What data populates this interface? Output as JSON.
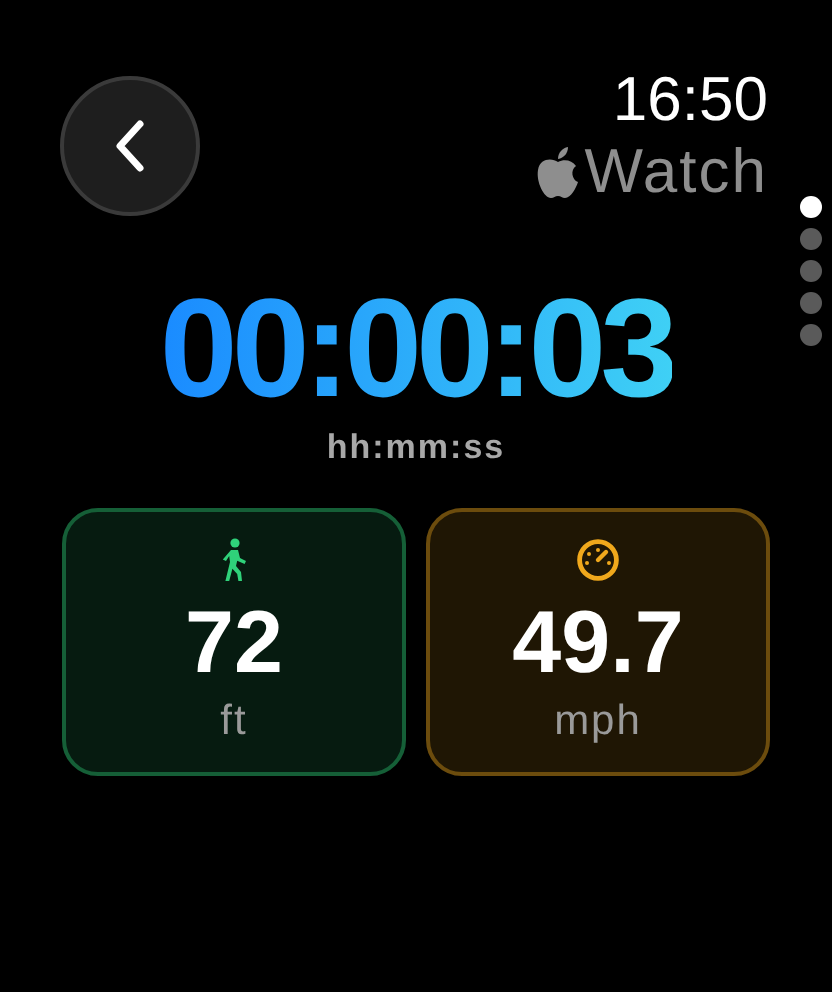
{
  "header": {
    "time": "16:50",
    "device_label": "Watch"
  },
  "pages": [
    {
      "selected": true
    },
    {
      "selected": false
    },
    {
      "selected": false
    },
    {
      "selected": false
    },
    {
      "selected": false
    }
  ],
  "timer": {
    "value": "00:00:03",
    "format": "hh:mm:ss"
  },
  "metrics": [
    {
      "kind": "walk",
      "value": "72",
      "unit": "ft",
      "color": "#2fd27a"
    },
    {
      "kind": "speed",
      "value": "49.7",
      "unit": "mph",
      "color": "#f0a81c"
    }
  ]
}
